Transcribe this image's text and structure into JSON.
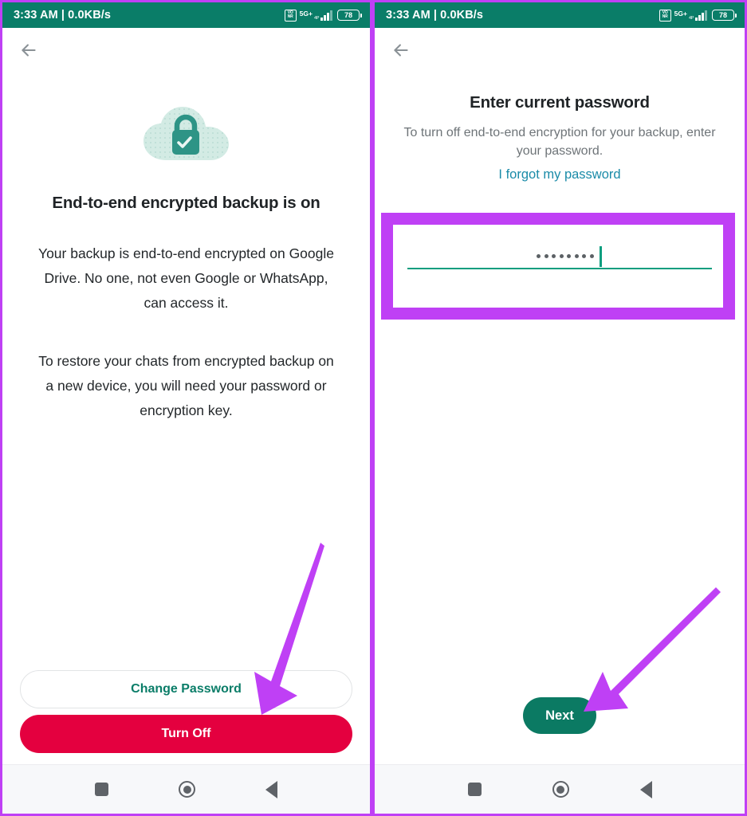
{
  "meta": {
    "accent_teal": "#0a7d68",
    "accent_green_line": "#0a9e7f",
    "danger_red": "#e4003f",
    "link_blue": "#1a8ba8",
    "annotation_purple": "#bf40f5",
    "status_bar_bg": "#0a7d68"
  },
  "status_bar": {
    "time_and_speed": "3:33 AM | 0.0KB/s",
    "vonr_line1": "VO",
    "vonr_line2": "NR",
    "network_label": "5G+",
    "network_sub": "4P",
    "battery_percent": "78"
  },
  "screen_left": {
    "back_icon": "arrow-left-icon",
    "cloud_icon": "cloud-lock-icon",
    "headline": "End-to-end encrypted backup is on",
    "paragraph_1": "Your backup is end-to-end encrypted on Google Drive. No one, not even Google or WhatsApp, can access it.",
    "paragraph_2": "To restore your chats from encrypted backup on a new device, you will need your password or encryption key.",
    "change_password_label": "Change Password",
    "turn_off_label": "Turn Off"
  },
  "screen_right": {
    "back_icon": "arrow-left-icon",
    "title": "Enter current password",
    "subtitle": "To turn off end-to-end encryption for your backup, enter your password.",
    "forgot_link": "I forgot my password",
    "password_value": "••••••••",
    "password_dot_count": 8,
    "next_label": "Next"
  },
  "nav_bar": {
    "recents_icon": "square-recents-icon",
    "home_icon": "circle-home-icon",
    "back_icon": "triangle-back-icon"
  },
  "annotations": {
    "arrow_1_target": "Turn Off",
    "arrow_2_target": "Next",
    "highlight_target": "password-input"
  }
}
